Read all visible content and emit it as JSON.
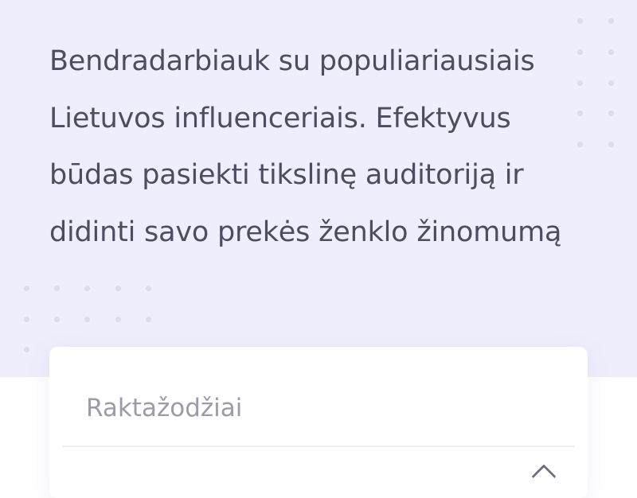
{
  "hero": {
    "description": "Bendradarbiauk su populiariausiais\nLietuvos influenceriais. Efektyvus\nbūdas pasiekti tikslinę auditoriją ir\ndidinti savo prekės ženklo žinomumą"
  },
  "search": {
    "keywords_placeholder": "Raktažodžiai",
    "keywords_value": ""
  },
  "icons": {
    "decor_dots": "dot-grid-decoration",
    "select_arrow": "chevron-up-icon"
  },
  "colors": {
    "hero_background": "#eeeefc",
    "text": "#4e4c61",
    "placeholder": "#9e9aa9",
    "dots": "#dcdcee"
  }
}
